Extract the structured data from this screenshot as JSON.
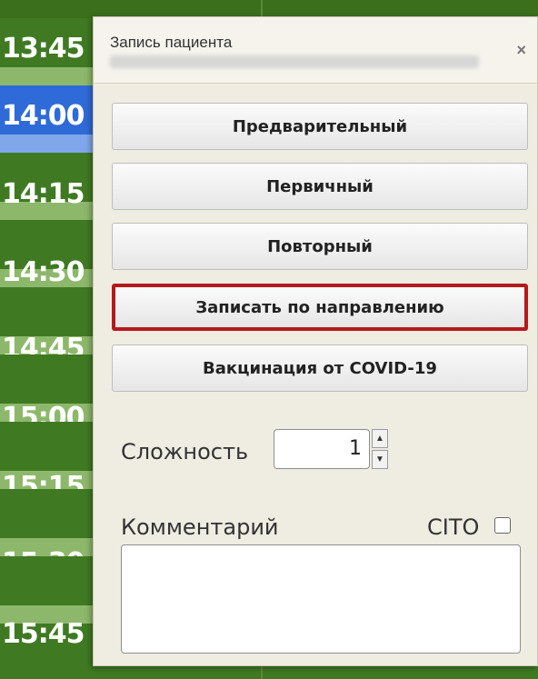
{
  "schedule": {
    "times": [
      "13:45",
      "14:00",
      "14:15",
      "14:30",
      "14:45",
      "15:00",
      "15:15",
      "15:30",
      "15:45"
    ],
    "selected_time": "14:00"
  },
  "dialog": {
    "title": "Запись пациента",
    "close_label": "×",
    "buttons": {
      "preliminary": "Предварительный",
      "primary": "Первичный",
      "repeat": "Повторный",
      "by_referral": "Записать по направлению",
      "covid_vaccination": "Вакцинация от COVID-19"
    },
    "complexity": {
      "label": "Сложность",
      "value": "1",
      "up_glyph": "▲",
      "down_glyph": "▼"
    },
    "comment": {
      "label": "Комментарий",
      "value": ""
    },
    "cito": {
      "label": "CITO",
      "checked": false
    }
  },
  "colors": {
    "slot_green": "#3f7a22",
    "slot_selected": "#2f6bd8",
    "highlight_border": "#b51a1a"
  }
}
